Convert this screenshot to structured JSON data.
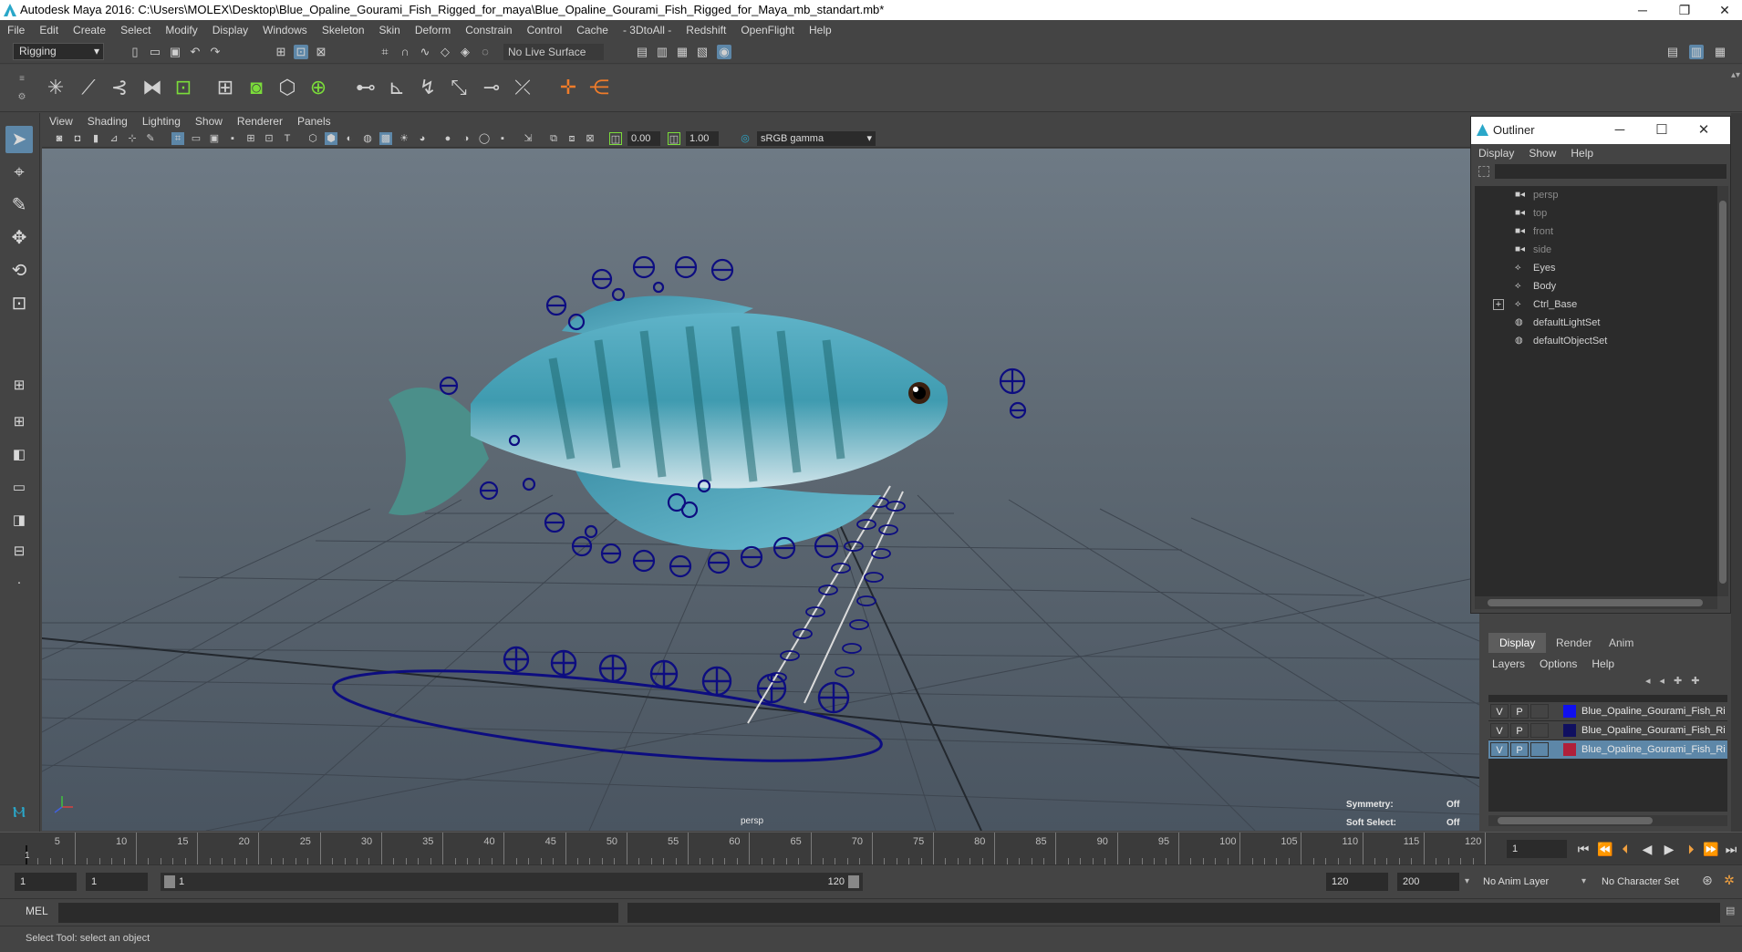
{
  "title": "Autodesk Maya 2016: C:\\Users\\MOLEX\\Desktop\\Blue_Opaline_Gourami_Fish_Rigged_for_maya\\Blue_Opaline_Gourami_Fish_Rigged_for_Maya_mb_standart.mb*",
  "window_controls": {
    "minimize": "─",
    "restore": "❐",
    "close": "✕"
  },
  "menubar": [
    "File",
    "Edit",
    "Create",
    "Select",
    "Modify",
    "Display",
    "Windows",
    "Skeleton",
    "Skin",
    "Deform",
    "Constrain",
    "Control",
    "Cache",
    "- 3DtoAll -",
    "Redshift",
    "OpenFlight",
    "Help"
  ],
  "toolbar": {
    "mode": "Rigging",
    "live_surface": "No Live Surface"
  },
  "panel_menu": [
    "View",
    "Shading",
    "Lighting",
    "Show",
    "Renderer",
    "Panels"
  ],
  "panel_toolbar": {
    "near": "0.00",
    "far": "1.00",
    "color_space": "sRGB gamma"
  },
  "viewport": {
    "camera_label": "persp",
    "hud": {
      "symmetry_label": "Symmetry:",
      "symmetry_value": "Off",
      "soft_select_label": "Soft Select:",
      "soft_select_value": "Off"
    }
  },
  "outliner": {
    "title": "Outliner",
    "menu": [
      "Display",
      "Show",
      "Help"
    ],
    "items": [
      {
        "label": "persp",
        "icon": "camera-icon",
        "dim": true
      },
      {
        "label": "top",
        "icon": "camera-icon",
        "dim": true
      },
      {
        "label": "front",
        "icon": "camera-icon",
        "dim": true
      },
      {
        "label": "side",
        "icon": "camera-icon",
        "dim": true
      },
      {
        "label": "Eyes",
        "icon": "mesh-icon",
        "dim": false
      },
      {
        "label": "Body",
        "icon": "mesh-icon",
        "dim": false
      },
      {
        "label": "Ctrl_Base",
        "icon": "transform-icon",
        "dim": false,
        "expandable": true
      },
      {
        "label": "defaultLightSet",
        "icon": "set-icon",
        "dim": false
      },
      {
        "label": "defaultObjectSet",
        "icon": "set-icon",
        "dim": false
      }
    ]
  },
  "layers": {
    "tabs": [
      "Display",
      "Render",
      "Anim"
    ],
    "active_tab": "Display",
    "menu": [
      "Layers",
      "Options",
      "Help"
    ],
    "rows": [
      {
        "v": "V",
        "p": "P",
        "color": "#1010ee",
        "name": "Blue_Opaline_Gourami_Fish_Rig",
        "selected": false
      },
      {
        "v": "V",
        "p": "P",
        "color": "#101060",
        "name": "Blue_Opaline_Gourami_Fish_Rig",
        "selected": false
      },
      {
        "v": "V",
        "p": "P",
        "color": "#b0203a",
        "name": "Blue_Opaline_Gourami_Fish_Rig",
        "selected": true
      }
    ]
  },
  "timeline": {
    "ticks": [
      "5",
      "10",
      "15",
      "20",
      "25",
      "30",
      "35",
      "40",
      "45",
      "50",
      "55",
      "60",
      "65",
      "70",
      "75",
      "80",
      "85",
      "90",
      "95",
      "100",
      "105",
      "110",
      "115",
      "120"
    ],
    "current_frame_marker": "1",
    "current_frame": "1"
  },
  "range": {
    "start": "1",
    "playback_start": "1",
    "slider_start": "1",
    "slider_end": "120",
    "playback_end": "120",
    "end": "200",
    "anim_layer": "No Anim Layer",
    "character_set": "No Character Set"
  },
  "command_line": {
    "lang": "MEL"
  },
  "help_line": "Select Tool: select an object",
  "colors": {
    "accent": "#5d87a8",
    "control_curve": "#0d0d80",
    "viewport_top": "#6e7a85",
    "viewport_bottom": "#4a5561"
  }
}
